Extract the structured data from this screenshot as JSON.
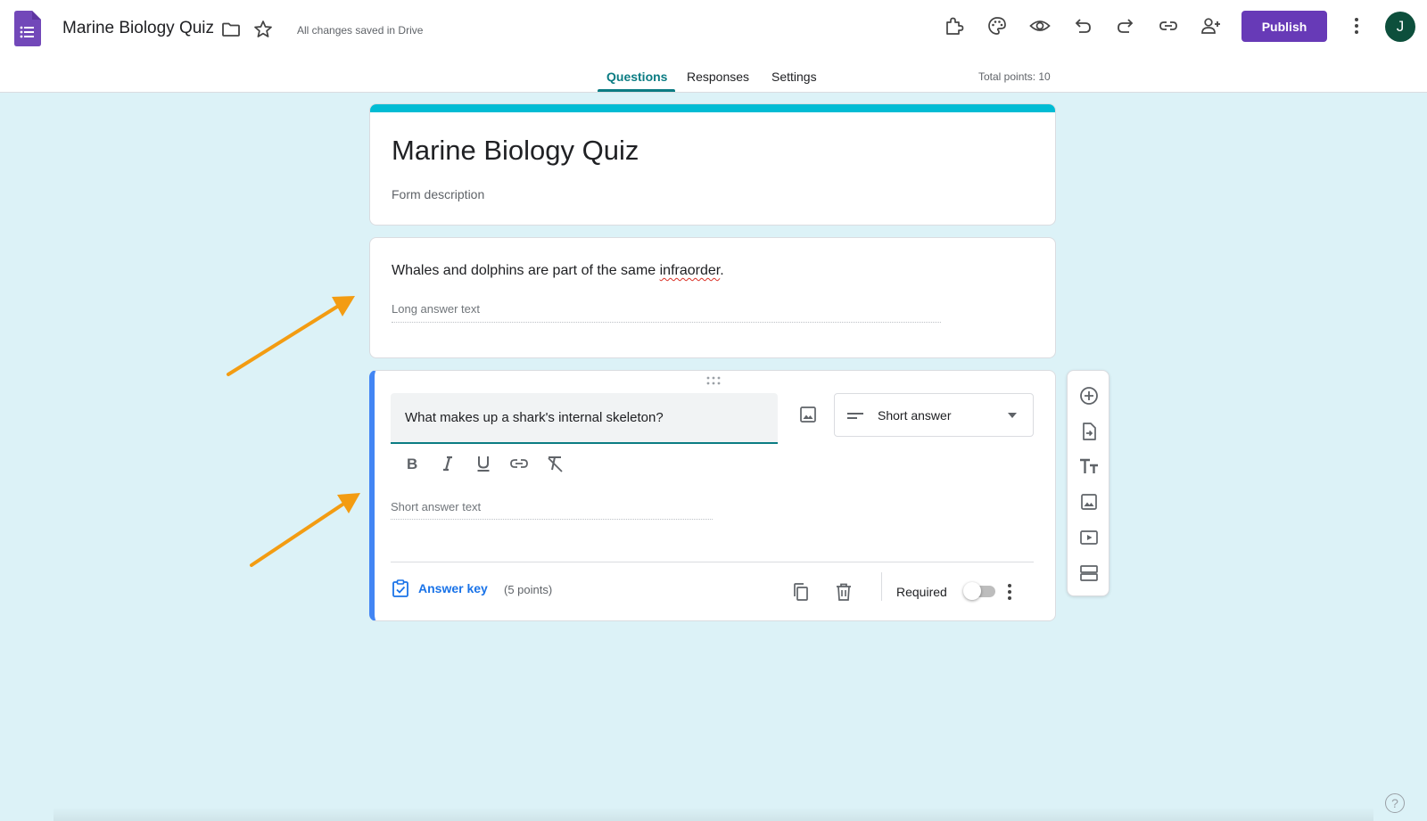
{
  "app": {
    "doc_title": "Marine Biology Quiz",
    "save_status": "All changes saved in Drive",
    "publish_label": "Publish",
    "avatar_initial": "J"
  },
  "tabs": [
    {
      "label": "Questions",
      "active": true
    },
    {
      "label": "Responses",
      "active": false
    },
    {
      "label": "Settings",
      "active": false
    }
  ],
  "total_points": "Total points: 10",
  "form": {
    "title": "Marine Biology Quiz",
    "description_placeholder": "Form description"
  },
  "questions": [
    {
      "text_before": "Whales and dolphins are part of the same ",
      "misspelled_word": "infraorder",
      "text_after": ".",
      "answer_placeholder": "Long answer text"
    },
    {
      "text": "What makes up a shark's internal skeleton?",
      "type": "Short answer",
      "answer_placeholder": "Short answer text",
      "answer_key_label": "Answer key",
      "points": "(5 points)",
      "required_label": "Required",
      "required": false
    }
  ],
  "colors": {
    "accent": "#673ab7",
    "tab_active": "#0b7c83",
    "header_bar": "#00bcd4",
    "question_focus": "#4285f4",
    "annotation_arrow": "#f39c12",
    "background": "#dcf2f7"
  },
  "icons": {
    "header": [
      "folder-icon",
      "star-icon",
      "addon-icon",
      "palette-icon",
      "preview-icon",
      "undo-icon",
      "redo-icon",
      "link-icon",
      "add-collaborator-icon",
      "more-vert-icon"
    ],
    "toolbar": [
      "add-question-icon",
      "import-questions-icon",
      "add-title-icon",
      "add-image-icon",
      "add-video-icon",
      "add-section-icon"
    ]
  }
}
